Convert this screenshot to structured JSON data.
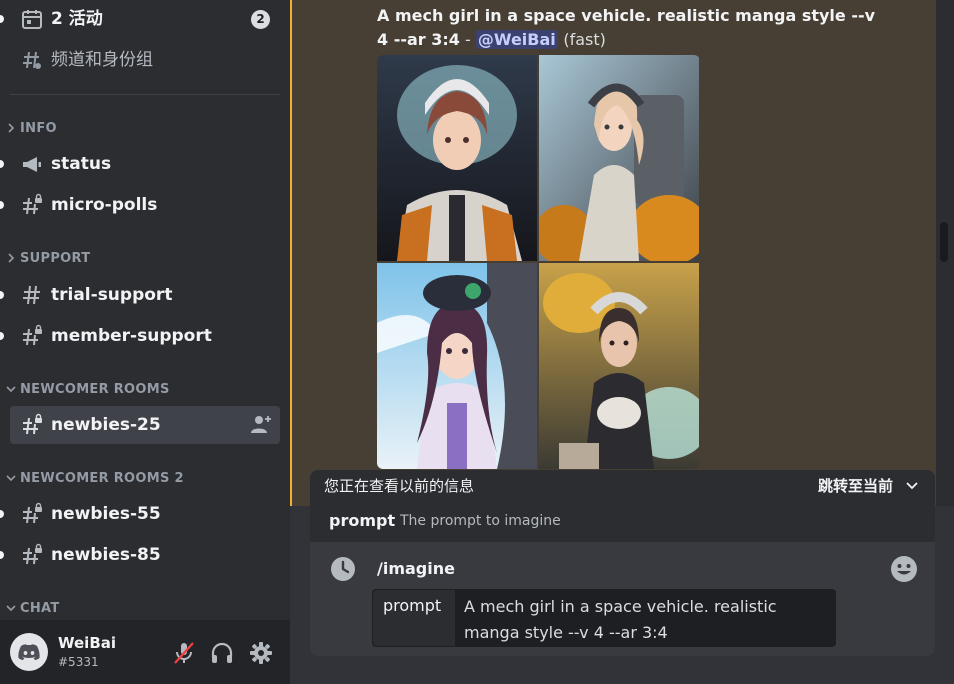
{
  "sidebar": {
    "top_items": [
      {
        "label": "2 活动",
        "badge": "2",
        "icon": "calendar-icon"
      },
      {
        "label": "频道和身份组",
        "icon": "channels-roles-icon"
      }
    ],
    "categories": [
      {
        "label": "INFO",
        "channels": [
          {
            "label": "status",
            "icon": "megaphone-icon"
          },
          {
            "label": "micro-polls",
            "icon": "locked-hash-icon"
          }
        ]
      },
      {
        "label": "SUPPORT",
        "channels": [
          {
            "label": "trial-support",
            "icon": "hash-icon"
          },
          {
            "label": "member-support",
            "icon": "locked-hash-icon"
          }
        ]
      },
      {
        "label": "NEWCOMER ROOMS",
        "channels": [
          {
            "label": "newbies-25",
            "icon": "locked-hash-icon",
            "active": true
          }
        ]
      },
      {
        "label": "NEWCOMER ROOMS 2",
        "channels": [
          {
            "label": "newbies-55",
            "icon": "locked-hash-icon"
          },
          {
            "label": "newbies-85",
            "icon": "locked-hash-icon"
          }
        ]
      },
      {
        "label": "CHAT",
        "channels": []
      }
    ]
  },
  "user": {
    "name": "WeiBai",
    "tag": "#5331"
  },
  "message": {
    "prompt_text": "A mech girl in a space vehicle. realistic manga style --v 4 --ar 3:4",
    "separator": " - ",
    "mention": "@WeiBai",
    "speed": "(fast)"
  },
  "banner": {
    "older_text": "您正在查看以前的信息",
    "jump_label": "跳转至当前"
  },
  "options": {
    "name": "prompt",
    "description": "The prompt to imagine"
  },
  "composer": {
    "command": "/imagine",
    "param_key": "prompt",
    "param_value": "A mech girl in a space vehicle. realistic manga style --v 4 --ar 3:4"
  },
  "colors": {
    "accent": "#f0b232",
    "mention_bg": "#3c4270",
    "highlight_bg": "#473f34"
  }
}
